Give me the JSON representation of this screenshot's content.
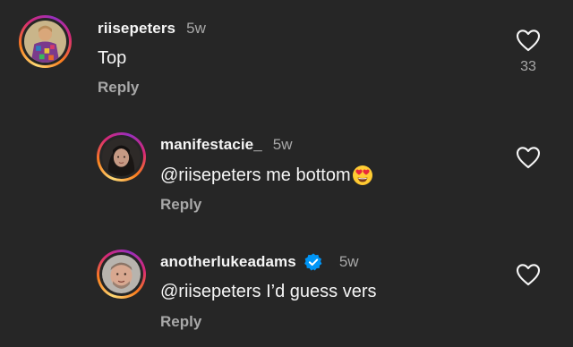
{
  "comments": [
    {
      "username": "riisepeters",
      "time": "5w",
      "text": "Top",
      "reply_label": "Reply",
      "like_count": "33",
      "verified": false
    },
    {
      "username": "manifestacie_",
      "time": "5w",
      "text": "@riisepeters me bottom",
      "emoji": "heart-eyes-emoji",
      "reply_label": "Reply",
      "verified": false
    },
    {
      "username": "anotherlukeadams",
      "time": "5w",
      "text": "@riisepeters I’d guess vers",
      "reply_label": "Reply",
      "verified": true
    }
  ],
  "colors": {
    "background": "#262626",
    "primary_text": "#f5f5f5",
    "secondary_text": "#a8a8a8",
    "verified_blue": "#0095f6"
  },
  "icons": {
    "like": "heart-outline-icon",
    "verified": "verified-badge-icon"
  }
}
